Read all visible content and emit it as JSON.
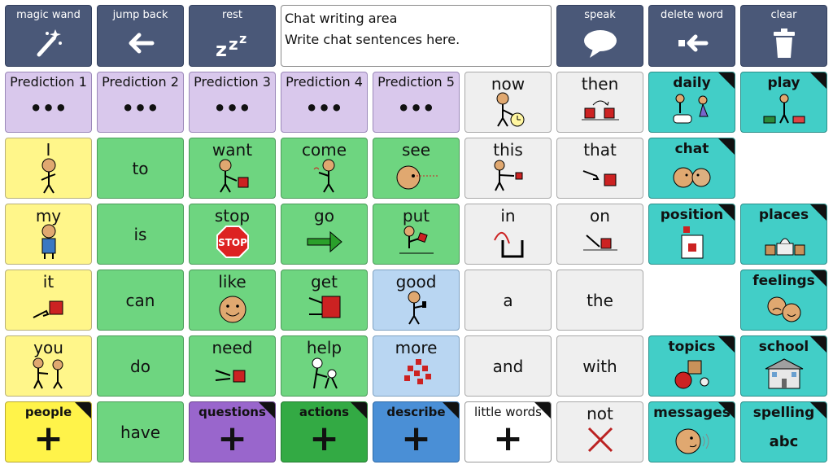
{
  "toolbar": {
    "magic_wand": "magic wand",
    "jump_back": "jump back",
    "rest": "rest",
    "speak": "speak",
    "delete_word": "delete word",
    "clear": "clear"
  },
  "chat_area": {
    "line1": "Chat writing area",
    "line2": "Write chat sentences here."
  },
  "predictions": [
    "Prediction 1",
    "Prediction 2",
    "Prediction 3",
    "Prediction 4",
    "Prediction 5"
  ],
  "prediction_dots": "•••",
  "words": {
    "now": "now",
    "then": "then",
    "I": "I",
    "to": "to",
    "want": "want",
    "come": "come",
    "see": "see",
    "this": "this",
    "that": "that",
    "my": "my",
    "is": "is",
    "stop": "stop",
    "go": "go",
    "put": "put",
    "in": "in",
    "on": "on",
    "it": "it",
    "can": "can",
    "like": "like",
    "get": "get",
    "good": "good",
    "a": "a",
    "the": "the",
    "you": "you",
    "do": "do",
    "need": "need",
    "help": "help",
    "more": "more",
    "and": "and",
    "with": "with",
    "have": "have",
    "not": "not"
  },
  "stop_sign_text": "STOP",
  "folders": {
    "daily": "daily",
    "play": "play",
    "chat": "chat",
    "position": "position",
    "places": "places",
    "feelings": "feelings",
    "topics": "topics",
    "school": "school",
    "messages": "messages",
    "spelling": "spelling",
    "spelling_sub": "abc"
  },
  "categories": {
    "people": "people",
    "questions": "questions",
    "actions": "actions",
    "describe": "describe",
    "little_words": "little words",
    "plus": "+"
  },
  "colors": {
    "toolbar": "#4a5878",
    "prediction": "#d9c8ec",
    "pronoun": "#fff68a",
    "verb": "#6ed580",
    "adjective": "#b9d6f2",
    "little_word": "#efefef",
    "folder": "#42cec7",
    "people_cat": "#fff34a",
    "questions_cat": "#9966cc",
    "actions_cat": "#33aa44",
    "describe_cat": "#4a8fd6"
  }
}
